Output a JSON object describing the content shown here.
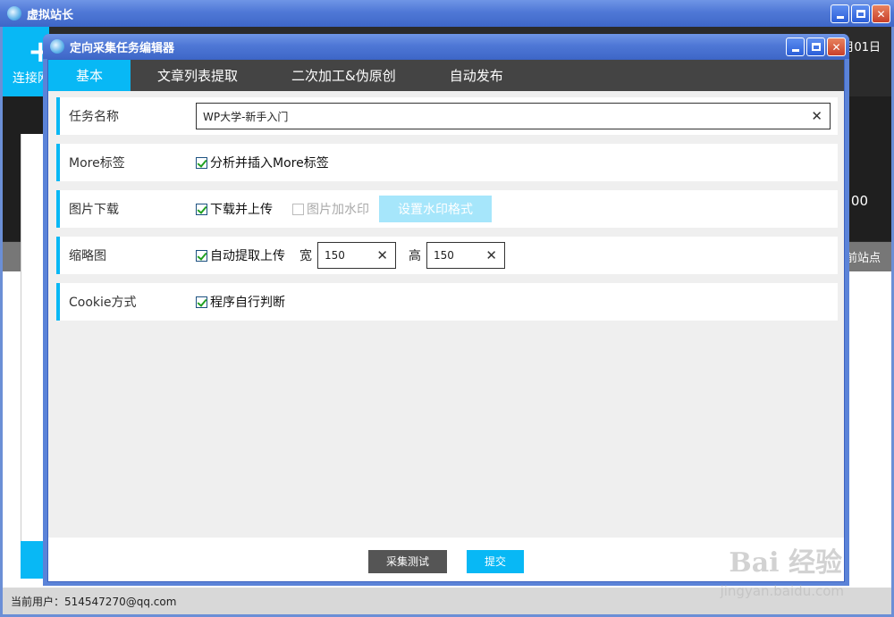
{
  "main": {
    "title": "虚拟站长",
    "connect_label": "连接网",
    "date_fragment": "月01日",
    "value_fragment": "00",
    "site_fragment": "前站点",
    "status": "当前用户：514547270@qq.com"
  },
  "dialog": {
    "title": "定向采集任务编辑器",
    "tabs": [
      {
        "label": "基本"
      },
      {
        "label": "文章列表提取"
      },
      {
        "label": "二次加工&伪原创"
      },
      {
        "label": "自动发布"
      }
    ],
    "rows": {
      "task_name": {
        "label": "任务名称",
        "value": "WP大学-新手入门"
      },
      "more_tag": {
        "label": "More标签",
        "option": "分析并插入More标签",
        "checked": true
      },
      "image_download": {
        "label": "图片下载",
        "option": "下载并上传",
        "checked": true,
        "watermark_option": "图片加水印",
        "watermark_checked": false,
        "watermark_button": "设置水印格式"
      },
      "thumbnail": {
        "label": "缩略图",
        "option": "自动提取上传",
        "checked": true,
        "width_label": "宽",
        "width_value": "150",
        "height_label": "高",
        "height_value": "150"
      },
      "cookie": {
        "label": "Cookie方式",
        "option": "程序自行判断",
        "checked": true
      }
    },
    "footer": {
      "test_button": "采集测试",
      "submit_button": "提交"
    }
  },
  "watermark": {
    "logo": "Bai 经验",
    "url": "jingyan.baidu.com"
  }
}
